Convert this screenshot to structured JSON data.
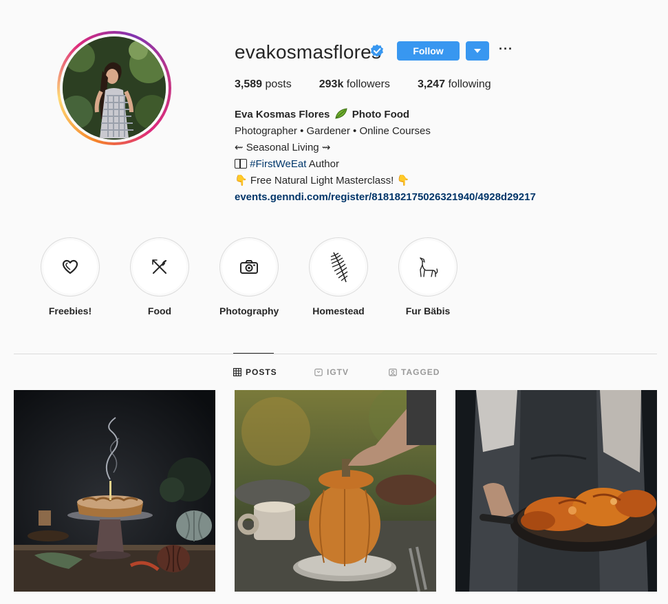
{
  "profile": {
    "username": "evakosmasflores",
    "verified": true,
    "follow_label": "Follow",
    "stats": {
      "posts_count": "3,589",
      "posts_label": "posts",
      "followers_count": "293k",
      "followers_label": "followers",
      "following_count": "3,247",
      "following_label": "following"
    },
    "bio": {
      "name": "Eva Kosmas Flores",
      "name_suffix": "Photo Food",
      "line1": "Photographer • Gardener • Online Courses",
      "line2": "⇜ Seasonal Living ⇝",
      "hashtag": "#FirstWeEat",
      "hashtag_suffix": "Author",
      "line4": "Free Natural Light Masterclass!",
      "link": "events.genndi.com/register/818182175026321940/4928d29217"
    }
  },
  "highlights": [
    {
      "label": "Freebies!",
      "icon": "heart-icon"
    },
    {
      "label": "Food",
      "icon": "fork-knife-icon"
    },
    {
      "label": "Photography",
      "icon": "camera-icon"
    },
    {
      "label": "Homestead",
      "icon": "fern-icon"
    },
    {
      "label": "Fur Bäbis",
      "icon": "howling-wolf-icon"
    }
  ],
  "tabs": [
    {
      "label": "POSTS",
      "icon": "grid-icon",
      "active": true
    },
    {
      "label": "IGTV",
      "icon": "tv-icon",
      "active": false
    },
    {
      "label": "TAGGED",
      "icon": "tag-icon",
      "active": false
    }
  ],
  "posts": [
    {
      "subject": "pie-on-cake-stand"
    },
    {
      "subject": "stuffed-pumpkin"
    },
    {
      "subject": "roast-chicken-pan"
    }
  ],
  "colors": {
    "follow_button": "#3897f0",
    "link": "#003569",
    "text": "#262626",
    "muted": "#999999",
    "border": "#dbdbdb",
    "background": "#fafafa"
  }
}
